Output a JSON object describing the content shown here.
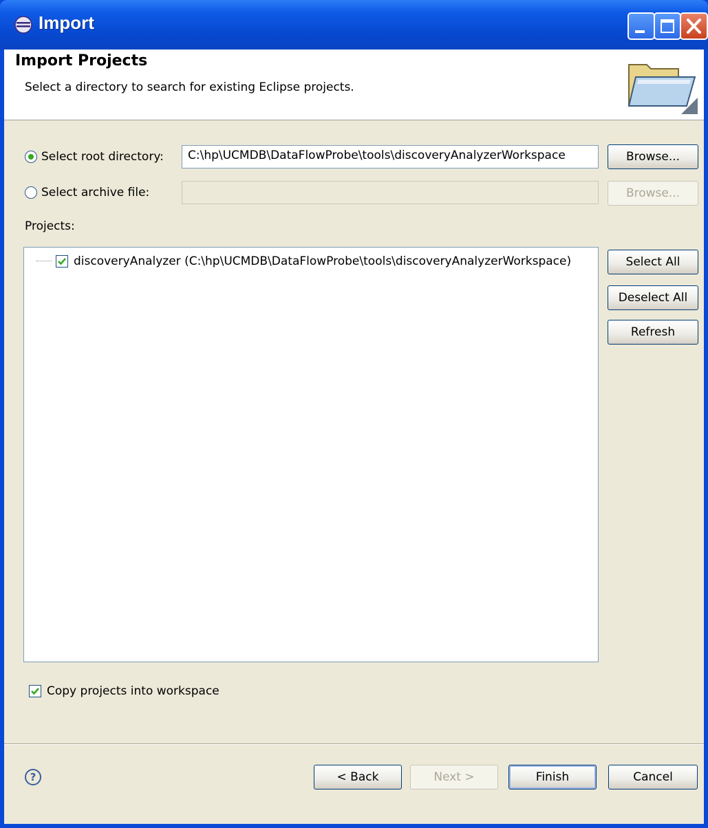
{
  "window": {
    "title": "Import",
    "icon": "eclipse-icon"
  },
  "header": {
    "title": "Import Projects",
    "description": "Select a directory to search for existing Eclipse projects.",
    "image": "folder-icon"
  },
  "source": {
    "root_label": "Select root directory:",
    "root_selected": true,
    "root_value": "C:\\hp\\UCMDB\\DataFlowProbe\\tools\\discoveryAnalyzerWorkspace",
    "root_browse": "Browse...",
    "archive_label": "Select archive file:",
    "archive_selected": false,
    "archive_value": "",
    "archive_browse": "Browse..."
  },
  "projects": {
    "label": "Projects:",
    "items": [
      {
        "label": "discoveryAnalyzer (C:\\hp\\UCMDB\\DataFlowProbe\\tools\\discoveryAnalyzerWorkspace)",
        "checked": true
      }
    ],
    "select_all": "Select All",
    "deselect_all": "Deselect All",
    "refresh": "Refresh"
  },
  "options": {
    "copy_label": "Copy projects into workspace",
    "copy_checked": true
  },
  "footer": {
    "back": "< Back",
    "next": "Next >",
    "finish": "Finish",
    "cancel": "Cancel",
    "help": "?"
  },
  "colors": {
    "titlebar": "#0a49d6",
    "dialog": "#ece9d8",
    "radio_dot": "#34a81f",
    "check": "#34a81f"
  }
}
